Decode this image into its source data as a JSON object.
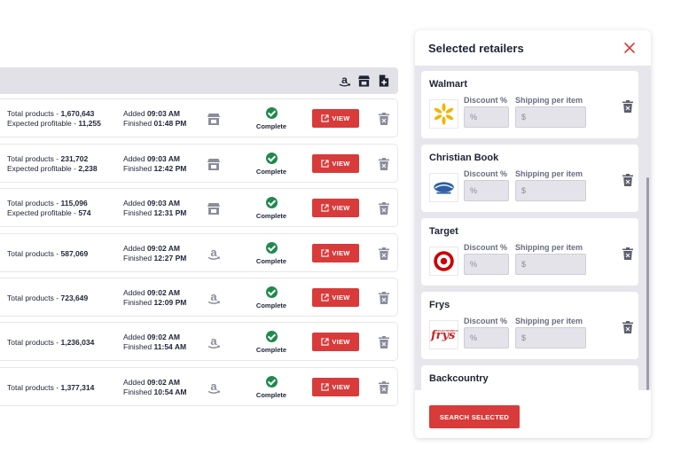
{
  "colors": {
    "accent": "#d93a3a",
    "success": "#1e8a4c",
    "toolbar": "#e3e1e8",
    "panel_bg": "#e7e6ec"
  },
  "toolbar": {
    "icons": [
      "amazon-icon",
      "store-icon",
      "add-file-icon"
    ]
  },
  "jobs": [
    {
      "products_label": "Total products - ",
      "products": "1,670,643",
      "profit_label": "Expected profitable - ",
      "profit": "11,255",
      "added_label": "Added ",
      "added": "09:03 AM",
      "finished_label": "Finished ",
      "finished": "01:48 PM",
      "source": "store",
      "status": "Complete",
      "view": "VIEW"
    },
    {
      "products_label": "Total products - ",
      "products": "231,702",
      "profit_label": "Expected profitable - ",
      "profit": "2,238",
      "added_label": "Added ",
      "added": "09:03 AM",
      "finished_label": "Finished ",
      "finished": "12:42 PM",
      "source": "store",
      "status": "Complete",
      "view": "VIEW"
    },
    {
      "products_label": "Total products - ",
      "products": "115,096",
      "profit_label": "Expected profitable - ",
      "profit": "574",
      "added_label": "Added ",
      "added": "09:03 AM",
      "finished_label": "Finished ",
      "finished": "12:31 PM",
      "source": "store",
      "status": "Complete",
      "view": "VIEW"
    },
    {
      "products_label": "Total products - ",
      "products": "587,069",
      "added_label": "Added ",
      "added": "09:02 AM",
      "finished_label": "Finished ",
      "finished": "12:27 PM",
      "source": "amazon",
      "status": "Complete",
      "view": "VIEW"
    },
    {
      "products_label": "Total products - ",
      "products": "723,649",
      "added_label": "Added ",
      "added": "09:02 AM",
      "finished_label": "Finished ",
      "finished": "12:09 PM",
      "source": "amazon",
      "status": "Complete",
      "view": "VIEW"
    },
    {
      "products_label": "Total products - ",
      "products": "1,236,034",
      "added_label": "Added ",
      "added": "09:02 AM",
      "finished_label": "Finished ",
      "finished": "11:54 AM",
      "source": "amazon",
      "status": "Complete",
      "view": "VIEW"
    },
    {
      "products_label": "Total products - ",
      "products": "1,377,314",
      "added_label": "Added ",
      "added": "09:02 AM",
      "finished_label": "Finished ",
      "finished": "10:54 AM",
      "source": "amazon",
      "status": "Complete",
      "view": "VIEW"
    }
  ],
  "panel": {
    "title": "Selected retailers",
    "discount_label": "Discount %",
    "shipping_label": "Shipping per item",
    "discount_placeholder": "%",
    "shipping_placeholder": "$",
    "search_button": "SEARCH SELECTED",
    "retailers": [
      {
        "name": "Walmart",
        "logo": "walmart-logo"
      },
      {
        "name": "Christian Book",
        "logo": "christianbook-logo"
      },
      {
        "name": "Target",
        "logo": "target-logo"
      },
      {
        "name": "Frys",
        "logo": "frys-logo",
        "logo_text": "frys",
        "logo_subtext": "ELECTRONICS"
      },
      {
        "name": "Backcountry",
        "logo": "backcountry-logo"
      }
    ]
  }
}
